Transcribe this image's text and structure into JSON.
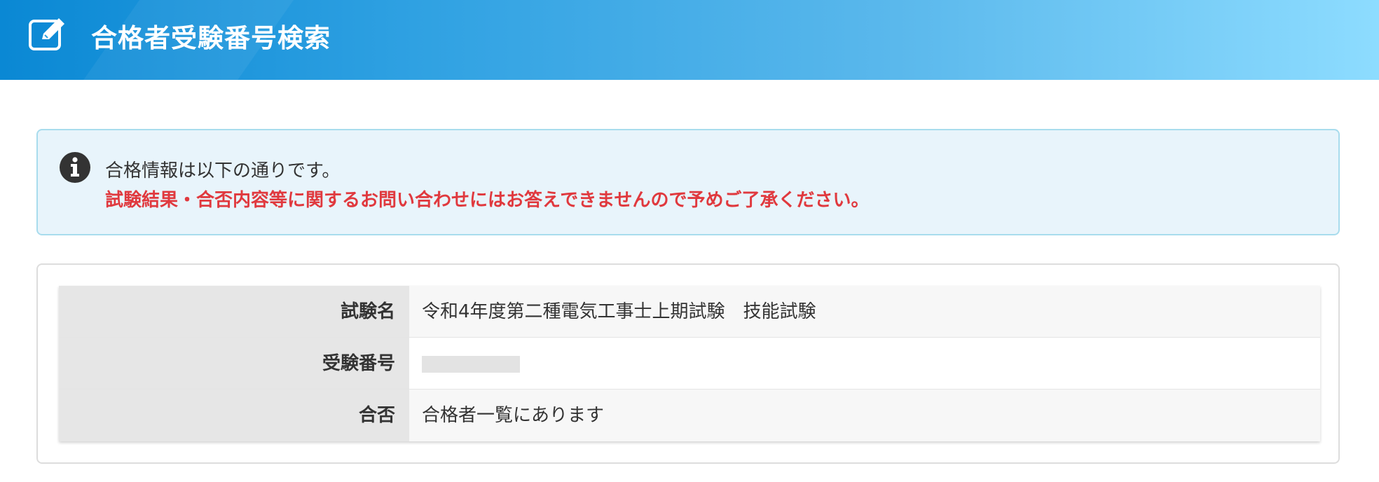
{
  "header": {
    "title": "合格者受験番号検索",
    "icon": "edit-icon"
  },
  "alert": {
    "icon": "info-icon",
    "message": "合格情報は以下の通りです。",
    "warning": "試験結果・合否内容等に関するお問い合わせにはお答えできませんので予めご了承ください。",
    "warning_color": "#e0393e"
  },
  "result_table": {
    "rows": [
      {
        "label": "試験名",
        "value": "令和4年度第二種電気工事士上期試験　技能試験"
      },
      {
        "label": "受験番号",
        "value": ""
      },
      {
        "label": "合否",
        "value": "合格者一覧にあります"
      }
    ]
  },
  "colors": {
    "header_gradient_start": "#0a88d4",
    "header_gradient_end": "#8ddcff",
    "alert_bg": "#e8f4fb",
    "alert_border": "#a8dced"
  }
}
